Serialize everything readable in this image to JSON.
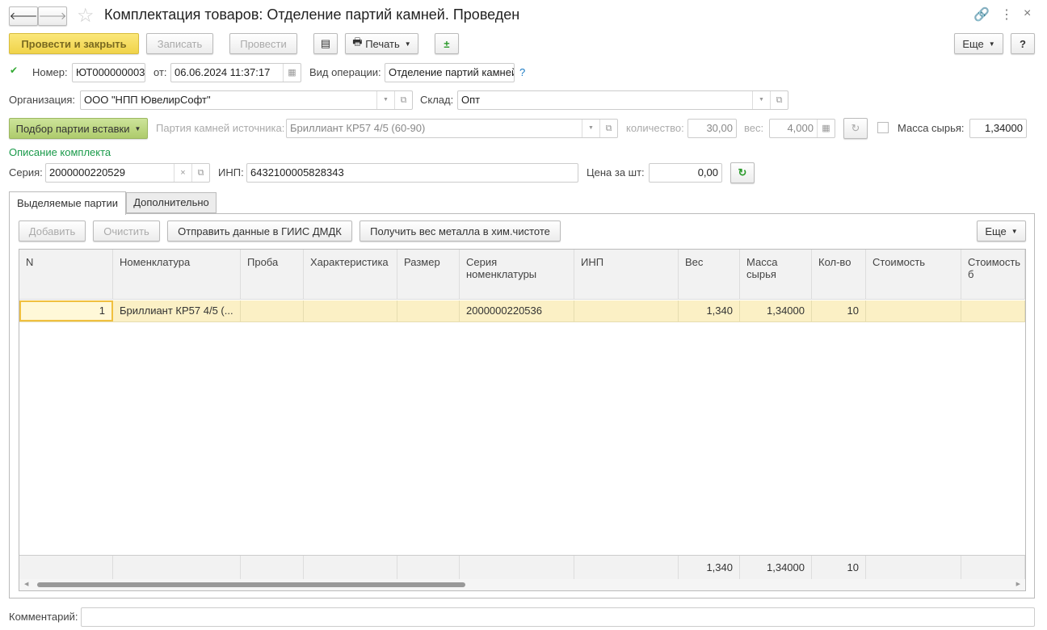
{
  "title": "Комплектация товаров: Отделение партий камней. Проведен",
  "toolbar": {
    "post_close": "Провести и закрыть",
    "write": "Записать",
    "post": "Провести",
    "print": "Печать",
    "more": "Еще",
    "help": "?"
  },
  "header": {
    "number_label": "Номер:",
    "number": "ЮТ000000003",
    "from_label": "от:",
    "date": "06.06.2024 11:37:17",
    "op_label": "Вид операции:",
    "op": "Отделение партий камней",
    "op_help": "?",
    "org_label": "Организация:",
    "org": "ООО \"НПП ЮвелирСофт\"",
    "wh_label": "Склад:",
    "wh": "Опт",
    "pick_btn": "Подбор партии вставки",
    "src_label": "Партия камней источника:",
    "src": "Бриллиант КР57 4/5 (60-90)",
    "qty_label": "количество:",
    "qty": "30,00",
    "weight_label": "вес:",
    "weight": "4,000",
    "raw_label": "Масса сырья:",
    "raw": "1,34000",
    "raw_checked": false
  },
  "kit": {
    "title": "Описание комплекта",
    "series_label": "Серия:",
    "series": "2000000220529",
    "inp_label": "ИНП:",
    "inp": "6432100005828343",
    "price_label": "Цена за шт:",
    "price": "0,00"
  },
  "tabs": [
    "Выделяемые партии",
    "Дополнительно"
  ],
  "table_toolbar": {
    "add": "Добавить",
    "clear": "Очистить",
    "send": "Отправить данные в ГИИС ДМДК",
    "get_weight": "Получить вес металла в хим.чистоте",
    "more": "Еще"
  },
  "table": {
    "columns": [
      "N",
      "Номенклатура",
      "Проба",
      "Характеристика",
      "Размер",
      "Серия номенклатуры",
      "ИНП",
      "Вес",
      "Масса сырья",
      "Кол-во",
      "Стоимость",
      "Стоимость б"
    ],
    "rows": [
      [
        "1",
        "Бриллиант КР57 4/5 (...",
        "",
        "",
        "",
        "2000000220536",
        "",
        "1,340",
        "1,34000",
        "10",
        "",
        ""
      ]
    ],
    "totals": [
      "",
      "",
      "",
      "",
      "",
      "",
      "",
      "1,340",
      "1,34000",
      "10",
      "",
      ""
    ]
  },
  "comment_label": "Комментарий:",
  "comment": "",
  "colors": {
    "accent": "#f5dc5a",
    "pick": "#b5d07a",
    "selected_row": "#fbf0c5",
    "link": "#1a7ac4",
    "green_title": "#1a9a4a"
  }
}
